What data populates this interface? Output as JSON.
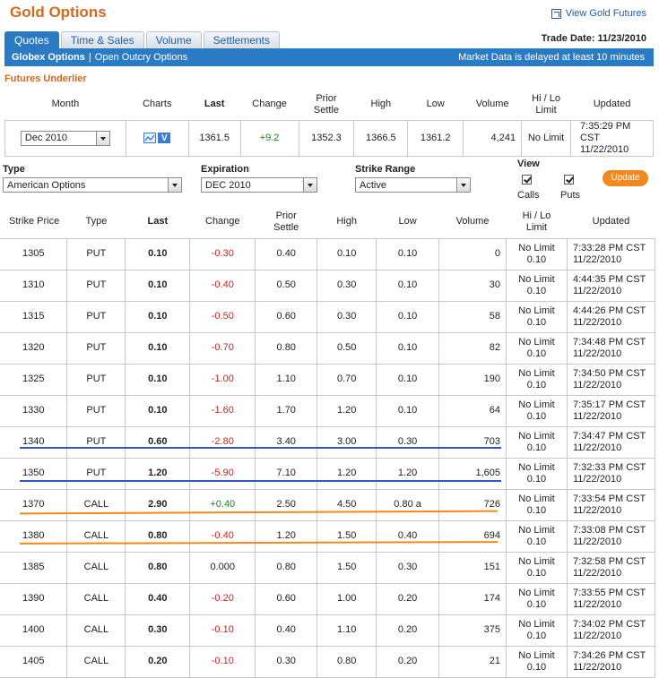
{
  "header": {
    "title": "Gold Options",
    "view_link": "View Gold Futures",
    "trade_date": "Trade Date: 11/23/2010"
  },
  "tabs": [
    "Quotes",
    "Time & Sales",
    "Volume",
    "Settlements"
  ],
  "subnav": {
    "active": "Globex Options",
    "separator": "|",
    "other": "Open Outcry Options",
    "delay_notice": "Market Data is delayed at least 10 minutes"
  },
  "futures": {
    "label": "Futures Underlier",
    "headers": [
      "Month",
      "Charts",
      "Last",
      "Change",
      "Prior Settle",
      "High",
      "Low",
      "Volume",
      "Hi / Lo Limit",
      "Updated"
    ],
    "row": {
      "month": "Dec 2010",
      "chart_v": "V",
      "last": "1361.5",
      "change": "+9.2",
      "prior_settle": "1352.3",
      "high": "1366.5",
      "low": "1361.2",
      "volume": "4,241",
      "limit": "No Limit",
      "updated_time": "7:35:29 PM CST",
      "updated_date": "11/22/2010"
    }
  },
  "filters": {
    "type_label": "Type",
    "type_value": "American Options",
    "expiration_label": "Expiration",
    "expiration_value": "DEC 2010",
    "strike_label": "Strike Range",
    "strike_value": "Active",
    "view_label": "View",
    "calls_label": "Calls",
    "puts_label": "Puts",
    "update_button": "Update"
  },
  "options": {
    "headers": [
      "Strike Price",
      "Type",
      "Last",
      "Change",
      "Prior Settle",
      "High",
      "Low",
      "Volume",
      "Hi / Lo Limit",
      "Updated"
    ],
    "rows": [
      {
        "strike": "1305",
        "type": "PUT",
        "last": "0.10",
        "change": "-0.30",
        "prior": "0.40",
        "high": "0.10",
        "low": "0.10",
        "volume": "0",
        "limit1": "No Limit",
        "limit2": "0.10",
        "time": "7:33:28 PM CST",
        "date": "11/22/2010"
      },
      {
        "strike": "1310",
        "type": "PUT",
        "last": "0.10",
        "change": "-0.40",
        "prior": "0.50",
        "high": "0.30",
        "low": "0.10",
        "volume": "30",
        "limit1": "No Limit",
        "limit2": "0.10",
        "time": "4:44:35 PM CST",
        "date": "11/22/2010"
      },
      {
        "strike": "1315",
        "type": "PUT",
        "last": "0.10",
        "change": "-0.50",
        "prior": "0.60",
        "high": "0.30",
        "low": "0.10",
        "volume": "58",
        "limit1": "No Limit",
        "limit2": "0.10",
        "time": "4:44:26 PM CST",
        "date": "11/22/2010"
      },
      {
        "strike": "1320",
        "type": "PUT",
        "last": "0.10",
        "change": "-0.70",
        "prior": "0.80",
        "high": "0.50",
        "low": "0.10",
        "volume": "82",
        "limit1": "No Limit",
        "limit2": "0.10",
        "time": "7:34:48 PM CST",
        "date": "11/22/2010"
      },
      {
        "strike": "1325",
        "type": "PUT",
        "last": "0.10",
        "change": "-1.00",
        "prior": "1.10",
        "high": "0.70",
        "low": "0.10",
        "volume": "190",
        "limit1": "No Limit",
        "limit2": "0.10",
        "time": "7:34:50 PM CST",
        "date": "11/22/2010"
      },
      {
        "strike": "1330",
        "type": "PUT",
        "last": "0.10",
        "change": "-1.60",
        "prior": "1.70",
        "high": "1.20",
        "low": "0.10",
        "volume": "64",
        "limit1": "No Limit",
        "limit2": "0.10",
        "time": "7:35:17 PM CST",
        "date": "11/22/2010"
      },
      {
        "strike": "1340",
        "type": "PUT",
        "last": "0.60",
        "change": "-2.80",
        "prior": "3.40",
        "high": "3.00",
        "low": "0.30",
        "volume": "703",
        "limit1": "No Limit",
        "limit2": "0.10",
        "time": "7:34:47 PM CST",
        "date": "11/22/2010"
      },
      {
        "strike": "1350",
        "type": "PUT",
        "last": "1.20",
        "change": "-5.90",
        "prior": "7.10",
        "high": "1.20",
        "low": "1.20",
        "volume": "1,605",
        "limit1": "No Limit",
        "limit2": "0.10",
        "time": "7:32:33 PM CST",
        "date": "11/22/2010"
      },
      {
        "strike": "1370",
        "type": "CALL",
        "last": "2.90",
        "change": "+0.40",
        "prior": "2.50",
        "high": "4.50",
        "low": "0.80 a",
        "volume": "726",
        "limit1": "No Limit",
        "limit2": "0.10",
        "time": "7:33:54 PM CST",
        "date": "11/22/2010"
      },
      {
        "strike": "1380",
        "type": "CALL",
        "last": "0.80",
        "change": "-0.40",
        "prior": "1.20",
        "high": "1.50",
        "low": "0.40",
        "volume": "694",
        "limit1": "No Limit",
        "limit2": "0.10",
        "time": "7:33:08 PM CST",
        "date": "11/22/2010"
      },
      {
        "strike": "1385",
        "type": "CALL",
        "last": "0.80",
        "change": "0.000",
        "prior": "0.80",
        "high": "1.50",
        "low": "0.30",
        "volume": "151",
        "limit1": "No Limit",
        "limit2": "0.10",
        "time": "7:32:58 PM CST",
        "date": "11/22/2010"
      },
      {
        "strike": "1390",
        "type": "CALL",
        "last": "0.40",
        "change": "-0.20",
        "prior": "0.60",
        "high": "1.00",
        "low": "0.20",
        "volume": "174",
        "limit1": "No Limit",
        "limit2": "0.10",
        "time": "7:33:55 PM CST",
        "date": "11/22/2010"
      },
      {
        "strike": "1400",
        "type": "CALL",
        "last": "0.30",
        "change": "-0.10",
        "prior": "0.40",
        "high": "1.10",
        "low": "0.20",
        "volume": "375",
        "limit1": "No Limit",
        "limit2": "0.10",
        "time": "7:34:02 PM CST",
        "date": "11/22/2010"
      },
      {
        "strike": "1405",
        "type": "CALL",
        "last": "0.20",
        "change": "-0.10",
        "prior": "0.30",
        "high": "0.80",
        "low": "0.20",
        "volume": "21",
        "limit1": "No Limit",
        "limit2": "0.10",
        "time": "7:34:26 PM CST",
        "date": "11/22/2010"
      }
    ]
  },
  "colors": {
    "accent_blue": "#2a7bc4",
    "title_orange": "#d2691e",
    "positive_green": "#1a8a1a",
    "negative_red": "#d42020",
    "underline_blue": "#3355cc",
    "underline_orange": "#f08a1c",
    "button_orange": "#f08a1c"
  }
}
